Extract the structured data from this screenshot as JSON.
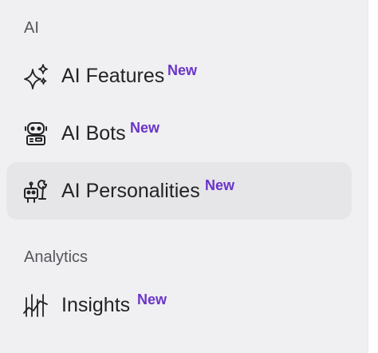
{
  "sections": {
    "ai": {
      "header": "AI",
      "items": [
        {
          "label": "AI Features",
          "badge": "New",
          "icon": "sparkles-icon"
        },
        {
          "label": "AI Bots",
          "badge": "New",
          "icon": "robot-icon"
        },
        {
          "label": "AI Personalities",
          "badge": "New",
          "icon": "robot-wrench-icon",
          "selected": true
        }
      ]
    },
    "analytics": {
      "header": "Analytics",
      "items": [
        {
          "label": "Insights",
          "badge": "New",
          "icon": "insights-chart-icon"
        }
      ]
    }
  },
  "colors": {
    "background": "#f0eff1",
    "selected_background": "#e6e5e8",
    "text": "#232327",
    "section_header": "#55555c",
    "badge": "#6a34c9"
  }
}
